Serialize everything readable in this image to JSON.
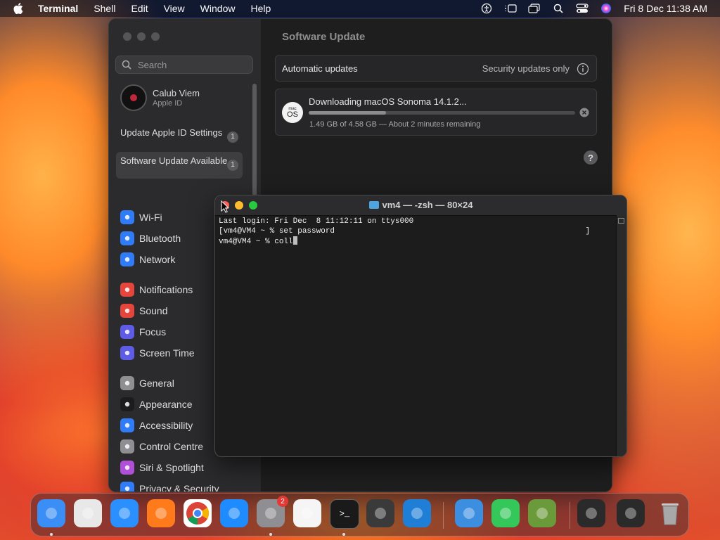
{
  "menubar": {
    "app_name": "Terminal",
    "items": [
      "Shell",
      "Edit",
      "View",
      "Window",
      "Help"
    ],
    "clock": "Fri 8 Dec  11:38 AM"
  },
  "settings": {
    "search_placeholder": "Search",
    "account": {
      "name": "Calub Viem",
      "sub": "Apple ID"
    },
    "notices": [
      {
        "label": "Update Apple ID Settings",
        "badge": "1"
      },
      {
        "label": "Software Update Available",
        "badge": "1"
      }
    ],
    "sidebar_items": [
      {
        "label": "Wi-Fi",
        "icon": "wifi-icon",
        "color": "#2f7cf6"
      },
      {
        "label": "Bluetooth",
        "icon": "bluetooth-icon",
        "color": "#2f7cf6"
      },
      {
        "label": "Network",
        "icon": "globe-icon",
        "color": "#2f7cf6"
      },
      {
        "label": "Notifications",
        "icon": "bell-icon",
        "color": "#e5453b"
      },
      {
        "label": "Sound",
        "icon": "speaker-icon",
        "color": "#e5453b"
      },
      {
        "label": "Focus",
        "icon": "moon-icon",
        "color": "#5e5ce6"
      },
      {
        "label": "Screen Time",
        "icon": "hourglass-icon",
        "color": "#5e5ce6"
      },
      {
        "label": "General",
        "icon": "gear-icon",
        "color": "#8e8e93"
      },
      {
        "label": "Appearance",
        "icon": "appearance-icon",
        "color": "#1c1c1e"
      },
      {
        "label": "Accessibility",
        "icon": "accessibility-icon",
        "color": "#2f7cf6"
      },
      {
        "label": "Control Centre",
        "icon": "control-centre-icon",
        "color": "#8e8e93"
      },
      {
        "label": "Siri & Spotlight",
        "icon": "siri-icon",
        "color": "#b04fd8"
      },
      {
        "label": "Privacy & Security",
        "icon": "hand-icon",
        "color": "#2f7cf6"
      }
    ],
    "content": {
      "title": "Software Update",
      "automatic_label": "Automatic updates",
      "automatic_value": "Security updates only",
      "download_title": "Downloading macOS Sonoma 14.1.2...",
      "download_status": "1.49 GB of 4.58 GB — About 2 minutes remaining",
      "progress": 0.29,
      "os_icon_small": "mac",
      "os_icon_big": "OS",
      "help": "?"
    }
  },
  "terminal": {
    "title": "vm4 — -zsh — 80×24",
    "lines": [
      "Last login: Fri Dec  8 11:12:11 on ttys000",
      "[vm4@VM4 ~ % set password                                                      ]",
      "vm4@VM4 ~ % coll"
    ]
  },
  "dock": {
    "apps": [
      {
        "name": "finder",
        "color": "#3a8ef6"
      },
      {
        "name": "launchpad",
        "color": "#e8e8e8"
      },
      {
        "name": "safari",
        "color": "#2a90ff"
      },
      {
        "name": "firefox",
        "color": "#ff7a1a"
      },
      {
        "name": "chrome",
        "color": "#ffffff"
      },
      {
        "name": "app-store",
        "color": "#1e8cff"
      },
      {
        "name": "system-settings",
        "color": "#8e8e93",
        "badge": "2"
      },
      {
        "name": "textedit",
        "color": "#f5f5f5"
      },
      {
        "name": "terminal",
        "color": "#1a1a1a"
      },
      {
        "name": "garageband",
        "color": "#3a3a3a"
      },
      {
        "name": "vscode",
        "color": "#1f7fd6"
      },
      {
        "name": "weather",
        "color": "#3c8fe0"
      },
      {
        "name": "facetime",
        "color": "#34c759"
      },
      {
        "name": "minecraft",
        "color": "#6a9a3a"
      },
      {
        "name": "finder-window-1",
        "color": "#2a2a2a"
      },
      {
        "name": "finder-window-2",
        "color": "#2a2a2a"
      },
      {
        "name": "trash",
        "color": "#9a9a9a"
      }
    ]
  }
}
